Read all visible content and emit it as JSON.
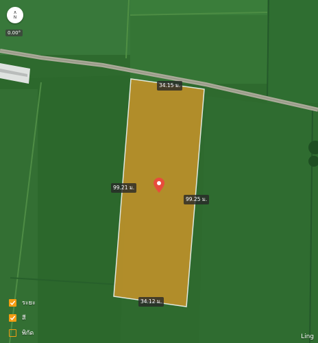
{
  "compass": {
    "direction_label": "N"
  },
  "heading": {
    "value": "0.00°"
  },
  "parcel": {
    "fill_color": "#c8942a",
    "edge_color": "#ffffff",
    "pin_color": "#e74c3c",
    "edges": {
      "top": "34.15 ม.",
      "left": "99.21 ม.",
      "right": "99.25 ม.",
      "bottom": "34.12 ม."
    }
  },
  "legend": {
    "accent_color": "#f39c12",
    "items": [
      {
        "label": "ระยะ",
        "checked": true
      },
      {
        "label": "สี",
        "checked": true
      },
      {
        "label": "พิกัด",
        "checked": false
      }
    ]
  },
  "attribution": "Ling"
}
